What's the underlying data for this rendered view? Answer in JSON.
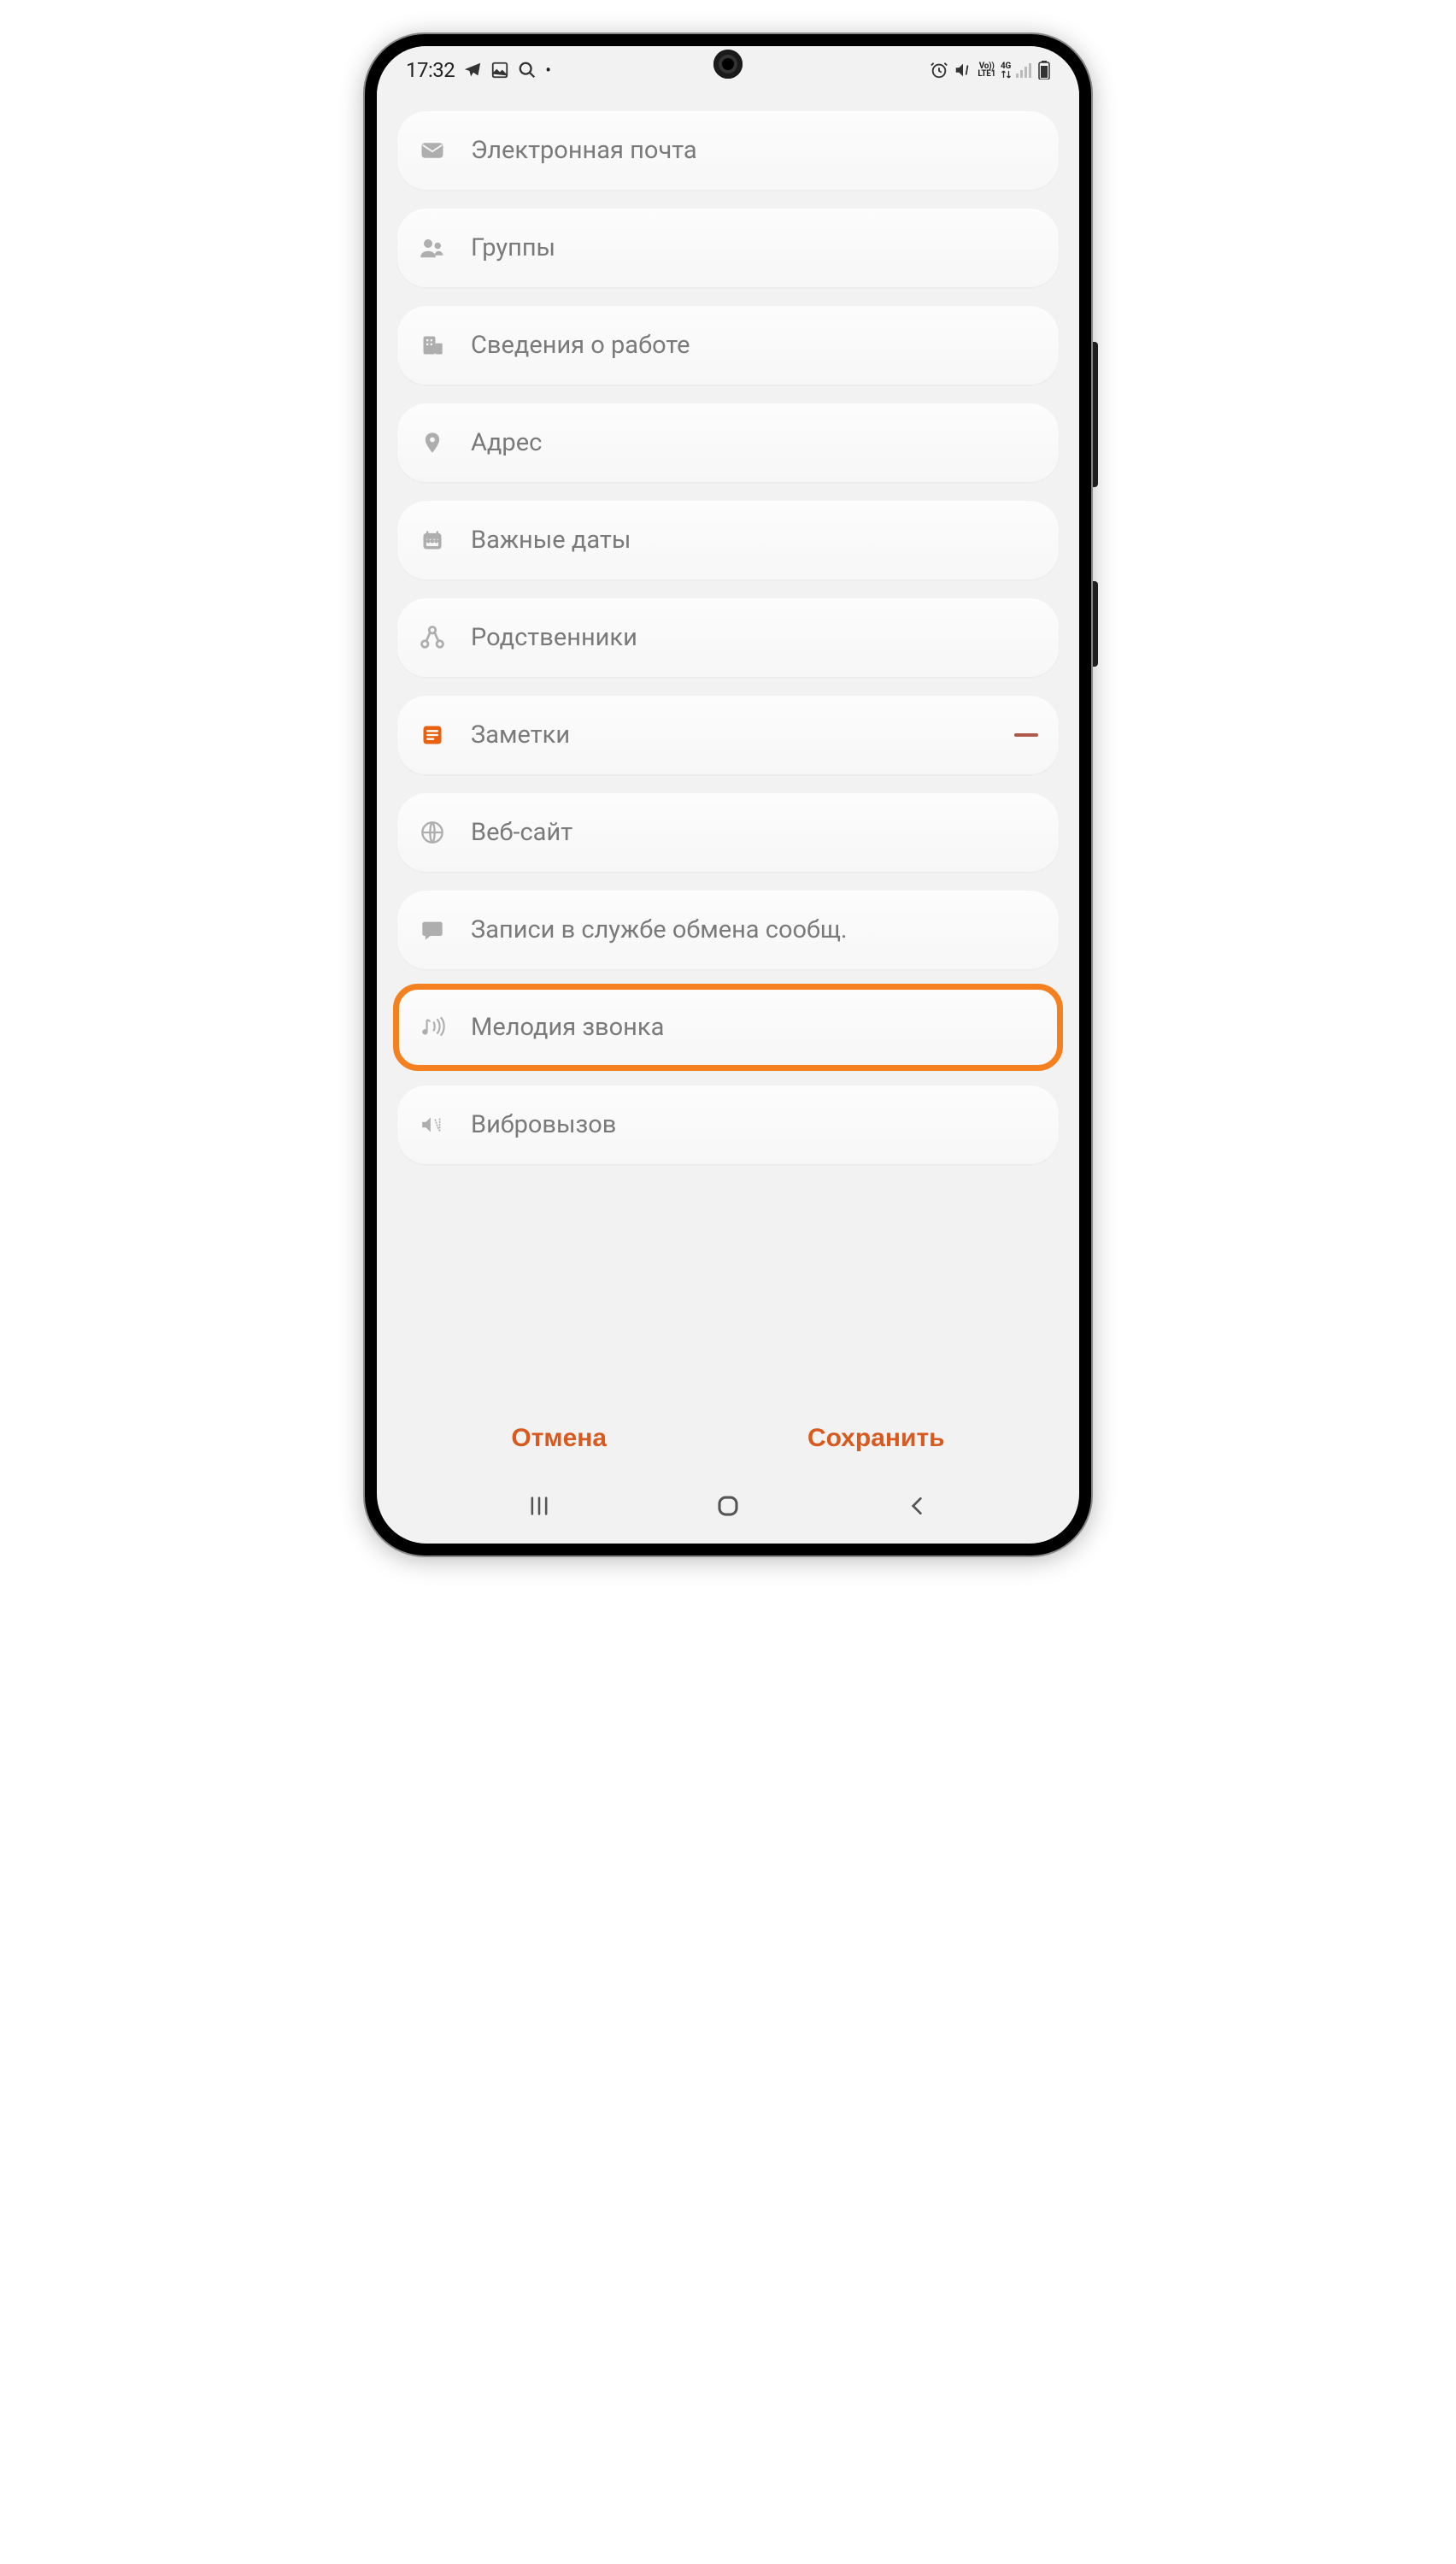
{
  "status_bar": {
    "time": "17:32",
    "network_label_1": "Vo))",
    "network_label_2": "LTE1",
    "network_label_3": "4G"
  },
  "fields": [
    {
      "icon": "email",
      "label": "Электронная почта"
    },
    {
      "icon": "groups",
      "label": "Группы"
    },
    {
      "icon": "work",
      "label": "Сведения о работе"
    },
    {
      "icon": "address",
      "label": "Адрес"
    },
    {
      "icon": "dates",
      "label": "Важные даты"
    },
    {
      "icon": "relatives",
      "label": "Родственники"
    },
    {
      "icon": "notes",
      "label": "Заметки",
      "accent": true,
      "removable": true
    },
    {
      "icon": "website",
      "label": "Веб-сайт"
    },
    {
      "icon": "messaging",
      "label": "Записи в службе обмена сообщ."
    },
    {
      "icon": "ringtone",
      "label": "Мелодия звонка",
      "highlighted": true
    },
    {
      "icon": "vibration",
      "label": "Вибровызов"
    }
  ],
  "actions": {
    "cancel": "Отмена",
    "save": "Сохранить"
  }
}
